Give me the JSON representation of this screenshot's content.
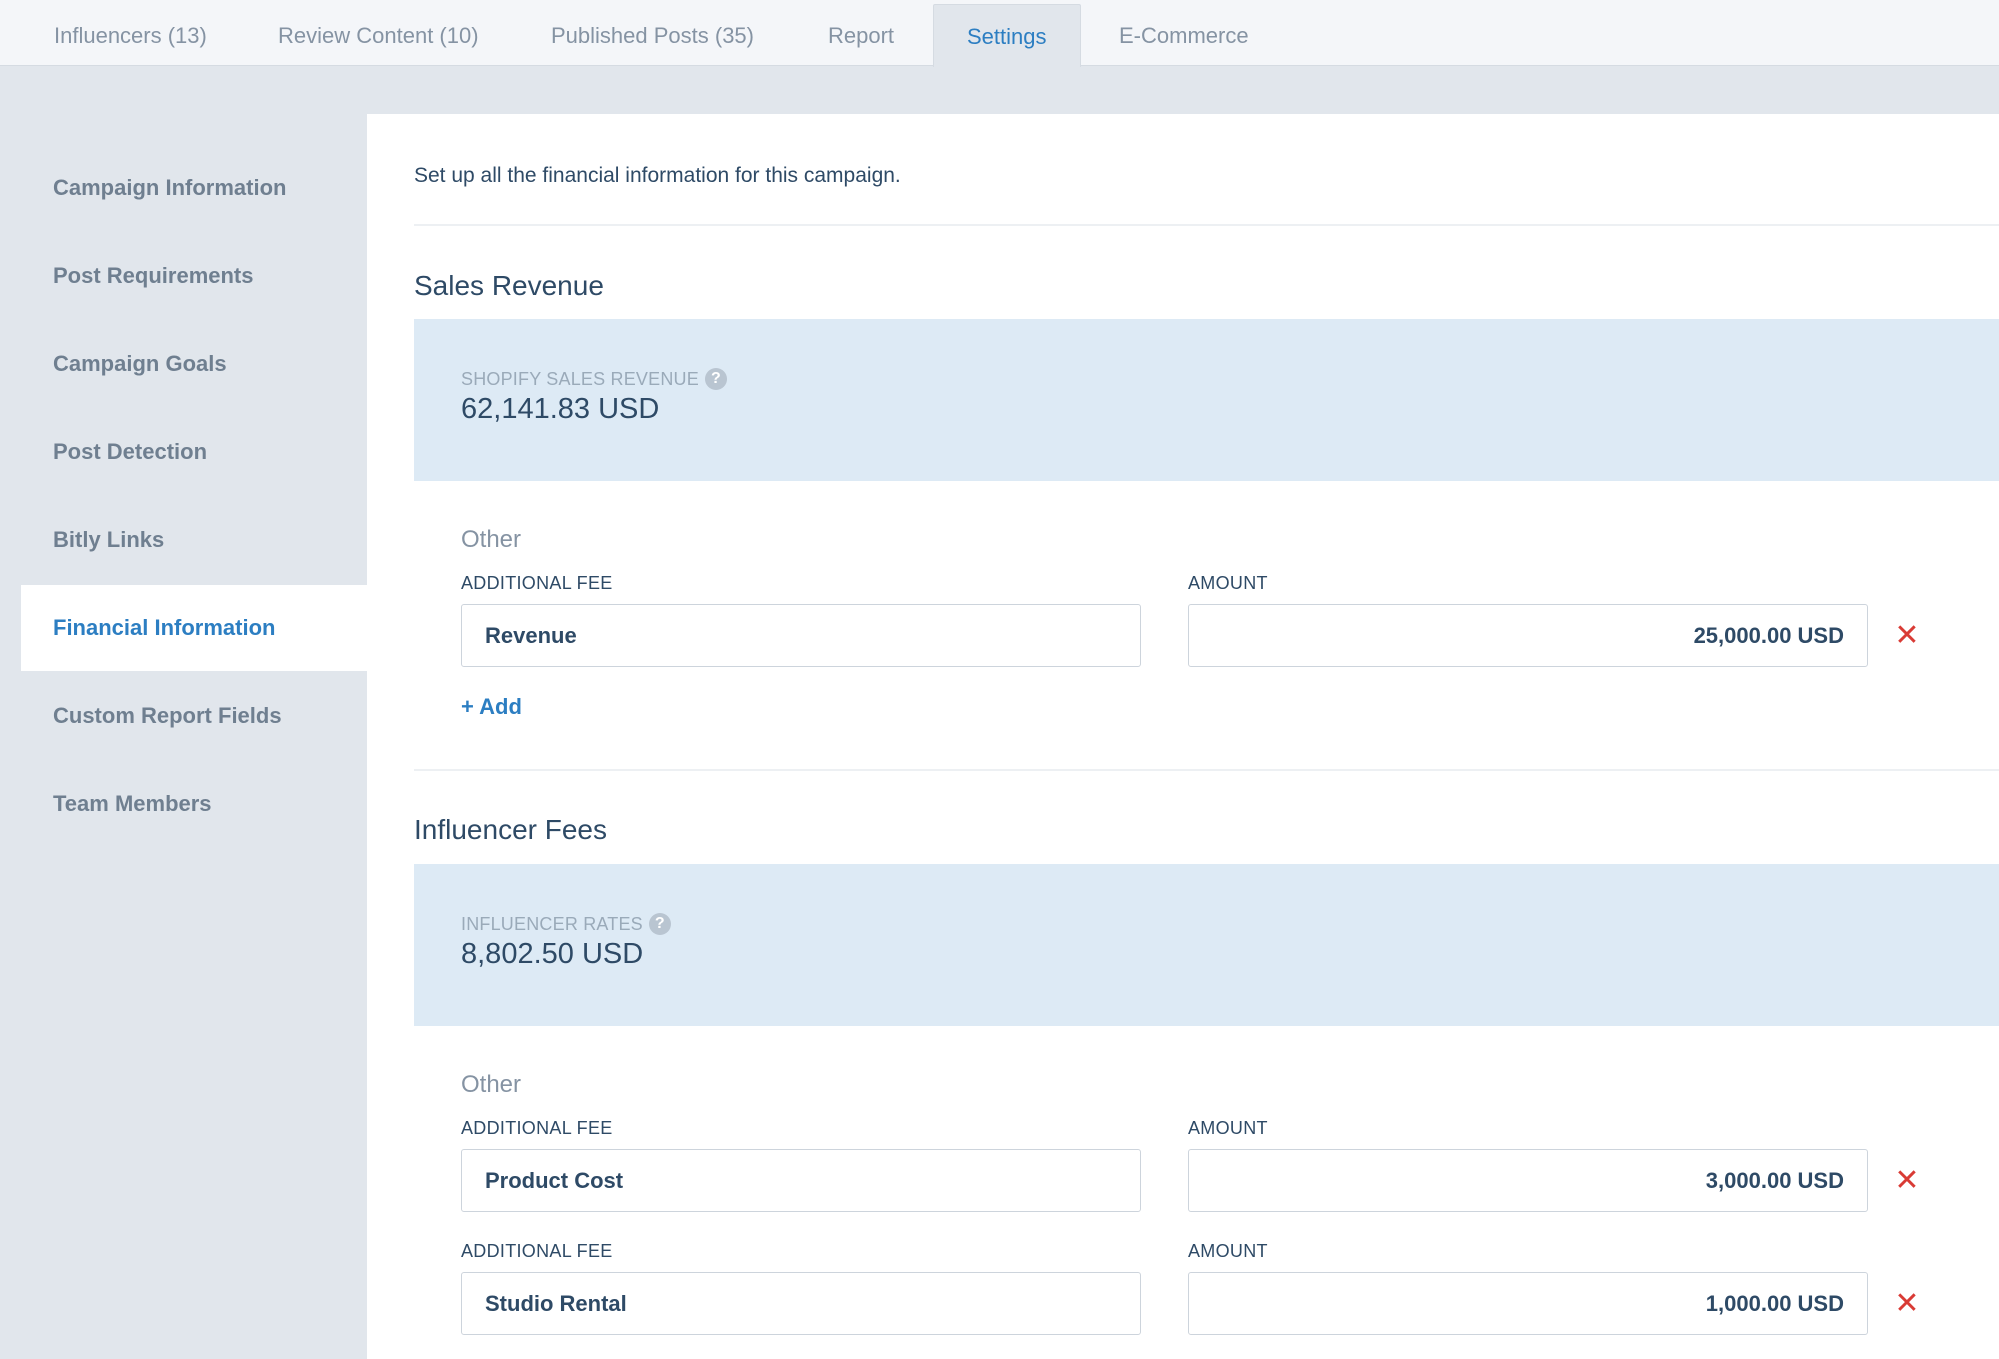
{
  "tabs": [
    {
      "label": "Influencers (13)"
    },
    {
      "label": "Review Content (10)"
    },
    {
      "label": "Published Posts (35)"
    },
    {
      "label": "Report"
    },
    {
      "label": "Settings"
    },
    {
      "label": "E-Commerce"
    }
  ],
  "sidebar": {
    "items": [
      {
        "label": "Campaign Information"
      },
      {
        "label": "Post Requirements"
      },
      {
        "label": "Campaign Goals"
      },
      {
        "label": "Post Detection"
      },
      {
        "label": "Bitly Links"
      },
      {
        "label": "Financial Information"
      },
      {
        "label": "Custom Report Fields"
      },
      {
        "label": "Team Members"
      }
    ]
  },
  "main": {
    "intro": "Set up all the financial information for this campaign.",
    "sales_revenue": {
      "title": "Sales Revenue",
      "summary_label": "SHOPIFY SALES REVENUE",
      "summary_value": "62,141.83 USD",
      "other_label": "Other",
      "fees": [
        {
          "fee_label": "ADDITIONAL FEE",
          "amount_label": "AMOUNT",
          "fee": "Revenue",
          "amount": "25,000.00 USD"
        }
      ],
      "add_label": "+ Add"
    },
    "influencer_fees": {
      "title": "Influencer Fees",
      "summary_label": "INFLUENCER RATES",
      "summary_value": "8,802.50 USD",
      "other_label": "Other",
      "fees": [
        {
          "fee_label": "ADDITIONAL FEE",
          "amount_label": "AMOUNT",
          "fee": "Product Cost",
          "amount": "3,000.00 USD"
        },
        {
          "fee_label": "ADDITIONAL FEE",
          "amount_label": "AMOUNT",
          "fee": "Studio Rental",
          "amount": "1,000.00 USD"
        }
      ]
    }
  },
  "icons": {
    "help": "?",
    "remove": "✕"
  },
  "colors": {
    "accent": "#2c7ec2",
    "danger": "#d93b35",
    "summary_bg": "#ddeaf5"
  }
}
